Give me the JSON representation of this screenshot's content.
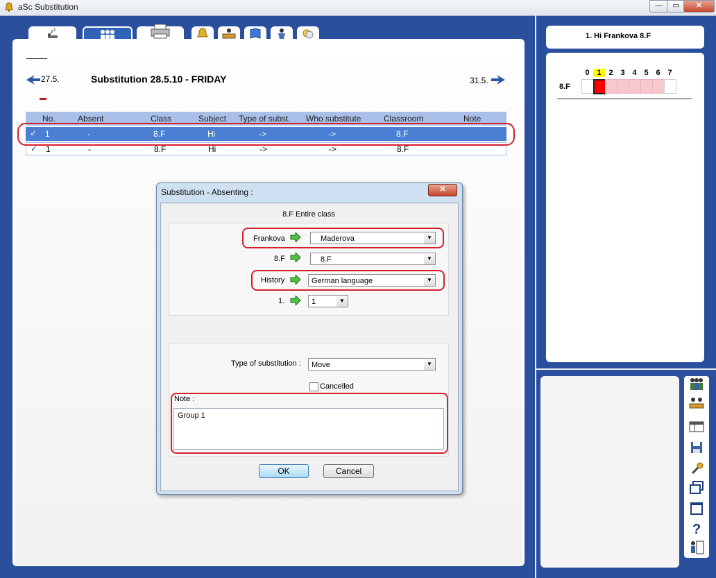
{
  "window": {
    "title": "aSc Substitution"
  },
  "header": {
    "prev_date": "27.5.",
    "title": "Substitution 28.5.10 - FRIDAY",
    "next_date": "31.5."
  },
  "table": {
    "columns": [
      "No.",
      "Absent",
      "Class",
      "Subject",
      "Type of subst.",
      "Who substitute",
      "Classroom",
      "Note"
    ],
    "rows": [
      {
        "no": "1",
        "absent": "-",
        "class": "8.F",
        "subject": "Hi",
        "type": "->",
        "who": "->",
        "classroom": "8.F",
        "note": ""
      },
      {
        "no": "1",
        "absent": "-",
        "class": "8.F",
        "subject": "Hi",
        "type": "->",
        "who": "->",
        "classroom": "8.F",
        "note": ""
      }
    ]
  },
  "right_panel": {
    "header": "1. Hi Frankova 8.F",
    "periods": [
      "0",
      "1",
      "2",
      "3",
      "4",
      "5",
      "6",
      "7"
    ],
    "row_label": "8.F"
  },
  "dialog": {
    "title": "Substitution - Absenting :",
    "subtitle": "8.F Entire class",
    "teacher_label": "Frankova",
    "teacher_value": "Maderova",
    "class_label": "8.F",
    "class_value": "8.F",
    "subject_label": "History",
    "subject_value": "German language",
    "period_label": "1.",
    "period_value": "1",
    "type_label": "Type of substitution :",
    "type_value": "Move",
    "cancelled_label": "Cancelled",
    "note_label": "Note :",
    "note_value": "Group 1",
    "ok_label": "OK",
    "cancel_label": "Cancel"
  },
  "colors": {
    "frame": "#2a4f9c",
    "selected_row": "#4a7fd4",
    "highlight": "#d61f2b",
    "current_period": "#ff0000"
  }
}
